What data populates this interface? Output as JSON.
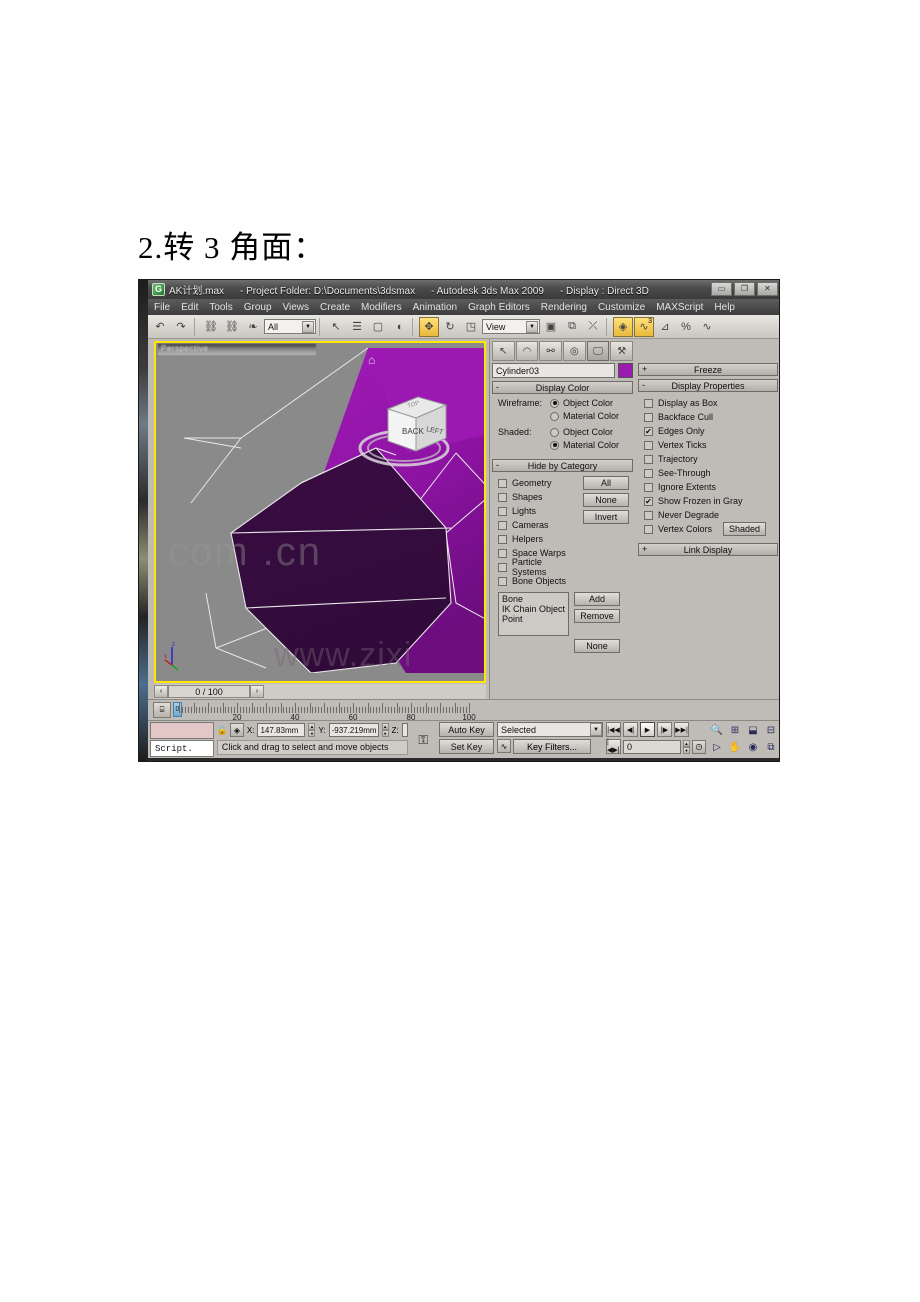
{
  "document": {
    "heading": "2.转 3 角面："
  },
  "window": {
    "app_icon": "3dsmax-logo-icon",
    "title_segments": [
      "AK计划.max",
      "- Project Folder: D:\\Documents\\3dsmax",
      "- Autodesk 3ds Max  2009",
      "- Display : Direct 3D"
    ],
    "controls": [
      {
        "name": "minimize-button",
        "glyph": "▭"
      },
      {
        "name": "restore-button",
        "glyph": "❐"
      },
      {
        "name": "close-button",
        "glyph": "✕"
      }
    ]
  },
  "menubar": {
    "items": [
      "File",
      "Edit",
      "Tools",
      "Group",
      "Views",
      "Create",
      "Modifiers",
      "Animation",
      "Graph Editors",
      "Rendering",
      "Customize",
      "MAXScript",
      "Help"
    ]
  },
  "toolbar": {
    "buttons": [
      {
        "name": "undo-button",
        "glyph": "↶",
        "active": false
      },
      {
        "name": "redo-button",
        "glyph": "↷",
        "active": false
      },
      {
        "name": "select-and-link-button",
        "glyph": "⛓",
        "active": false
      },
      {
        "name": "unlink-selection-button",
        "glyph": "⛓",
        "active": false
      },
      {
        "name": "bind-to-space-warp-button",
        "glyph": "❧",
        "active": false
      },
      {
        "name": "select-object-button",
        "glyph": "↖",
        "active": false
      },
      {
        "name": "select-by-name-button",
        "glyph": "☰",
        "active": false
      },
      {
        "name": "rectangular-selection-region-button",
        "glyph": "▢",
        "active": false
      },
      {
        "name": "window-crossing-button",
        "glyph": "◖",
        "active": false
      },
      {
        "name": "select-and-move-button",
        "glyph": "✥",
        "active": true
      },
      {
        "name": "select-and-rotate-button",
        "glyph": "↻",
        "active": false
      },
      {
        "name": "select-and-scale-button",
        "glyph": "◳",
        "active": false
      },
      {
        "name": "use-pivot-center-button",
        "glyph": "▣",
        "active": false
      },
      {
        "name": "mirror-button",
        "glyph": "⧉",
        "active": false
      },
      {
        "name": "align-button",
        "glyph": "⤫",
        "active": false
      },
      {
        "name": "layer-manager-button",
        "glyph": "◈",
        "active": true
      },
      {
        "name": "curve-editor-button",
        "glyph": "∿",
        "active": true
      },
      {
        "name": "schematic-view-button",
        "glyph": "⊿",
        "active": false
      },
      {
        "name": "material-editor-button",
        "glyph": "%",
        "active": false
      },
      {
        "name": "render-setup-button",
        "glyph": "∿",
        "active": false
      }
    ],
    "selection_filter": {
      "name": "selection-filter-combo",
      "value": "All"
    },
    "reference_coordinate_system": {
      "name": "coordinate-system-combo",
      "value": "View"
    },
    "curve_editor_badge": "3"
  },
  "viewport": {
    "label": "Perspective",
    "home_icon": "home-icon",
    "watermark_main": "www.zixi",
    "watermark_panel": "com      .cn",
    "frame_counter": "0 / 100",
    "axis_labels": {
      "x": "x",
      "y": "y",
      "z": "z"
    },
    "view_cube": {
      "front_face": "BACK",
      "right_face": "LEFT",
      "top_face": "TOP"
    }
  },
  "command_panel": {
    "tabs": [
      {
        "name": "tab-create",
        "glyph": "↖",
        "active": false
      },
      {
        "name": "tab-modify",
        "glyph": "◠",
        "active": false
      },
      {
        "name": "tab-hierarchy",
        "glyph": "⚯",
        "active": false
      },
      {
        "name": "tab-motion",
        "glyph": "◎",
        "active": false
      },
      {
        "name": "tab-display",
        "glyph": "🖵",
        "active": true
      },
      {
        "name": "tab-utilities",
        "glyph": "⚒",
        "active": false
      }
    ],
    "object_name": "Cylinder03",
    "object_color": "#9b1ab0",
    "display_color": {
      "title": "Display Color",
      "collapse_glyph": "-",
      "rows": [
        {
          "label": "Wireframe:",
          "options": [
            {
              "label": "Object Color",
              "selected": true
            },
            {
              "label": "Material Color",
              "selected": false
            }
          ]
        },
        {
          "label": "Shaded:",
          "options": [
            {
              "label": "Object Color",
              "selected": false
            },
            {
              "label": "Material Color",
              "selected": true
            }
          ]
        }
      ]
    },
    "hide_by_category": {
      "title": "Hide by Category",
      "collapse_glyph": "-",
      "categories": [
        {
          "label": "Geometry",
          "checked": false
        },
        {
          "label": "Shapes",
          "checked": false
        },
        {
          "label": "Lights",
          "checked": false
        },
        {
          "label": "Cameras",
          "checked": false
        },
        {
          "label": "Helpers",
          "checked": false
        },
        {
          "label": "Space Warps",
          "checked": false
        },
        {
          "label": "Particle Systems",
          "checked": false
        },
        {
          "label": "Bone Objects",
          "checked": false
        }
      ],
      "side_buttons": [
        "All",
        "None",
        "Invert"
      ],
      "list_items": [
        "Bone",
        "IK Chain Object",
        "Point"
      ],
      "list_buttons": [
        "Add",
        "Remove"
      ],
      "none_button": "None"
    },
    "freeze": {
      "title": "Freeze",
      "collapse_glyph": "+"
    },
    "display_properties": {
      "title": "Display Properties",
      "collapse_glyph": "-",
      "options": [
        {
          "label": "Display as Box",
          "checked": false
        },
        {
          "label": "Backface Cull",
          "checked": false
        },
        {
          "label": "Edges Only",
          "checked": true
        },
        {
          "label": "Vertex Ticks",
          "checked": false
        },
        {
          "label": "Trajectory",
          "checked": false
        },
        {
          "label": "See-Through",
          "checked": false
        },
        {
          "label": "Ignore Extents",
          "checked": false
        },
        {
          "label": "Show Frozen in Gray",
          "checked": true
        },
        {
          "label": "Never Degrade",
          "checked": false
        },
        {
          "label": "Vertex Colors",
          "checked": false
        }
      ],
      "shaded_button": "Shaded"
    },
    "link_display": {
      "title": "Link Display",
      "collapse_glyph": "+"
    }
  },
  "trackbar": {
    "ticks_labels": [
      "20",
      "40",
      "60",
      "80",
      "100"
    ],
    "slider_value": "0",
    "key_mode_icon": "key-filter-icon"
  },
  "statusbar": {
    "mini_listener_prompt": "Script.",
    "lock_icon": "lock-icon",
    "absolute_mode_icon": "absolute-mode-transform-icon",
    "coordinates": [
      {
        "axis": "X:",
        "value": "147.83mm"
      },
      {
        "axis": "Y:",
        "value": "-937.219mm"
      },
      {
        "axis": "Z:",
        "value": ""
      }
    ],
    "key_icon": "key-icon",
    "prompt": "Click and drag to select and move objects",
    "auto_key": "Auto Key",
    "set_key": "Set Key",
    "selection_level": "Selected",
    "key_filters": "Key Filters...",
    "current_frame": "0",
    "playback_buttons": [
      {
        "name": "go-to-start-button",
        "glyph": "|◀◀"
      },
      {
        "name": "previous-frame-button",
        "glyph": "◀|"
      },
      {
        "name": "play-animation-button",
        "glyph": "▶",
        "active": true
      },
      {
        "name": "next-frame-button",
        "glyph": "|▶"
      },
      {
        "name": "go-to-end-button",
        "glyph": "▶▶|"
      }
    ],
    "nav_buttons_top": [
      {
        "name": "zoom-button",
        "glyph": "🔍"
      },
      {
        "name": "zoom-all-button",
        "glyph": "⊞"
      },
      {
        "name": "zoom-extents-button",
        "glyph": "⬓"
      },
      {
        "name": "zoom-extents-all-button",
        "glyph": "⊟"
      }
    ],
    "nav_buttons_bottom": [
      {
        "name": "field-of-view-button",
        "glyph": "▷"
      },
      {
        "name": "pan-view-button",
        "glyph": "✋"
      },
      {
        "name": "orbit-button",
        "glyph": "◉"
      },
      {
        "name": "maximize-viewport-toggle-button",
        "glyph": "⧉"
      }
    ],
    "time-config-button": {
      "name": "time-configuration-button",
      "glyph": "🕐"
    },
    "key_mode_toggle": {
      "name": "key-mode-toggle-button",
      "glyph": "|◀▶|"
    }
  }
}
